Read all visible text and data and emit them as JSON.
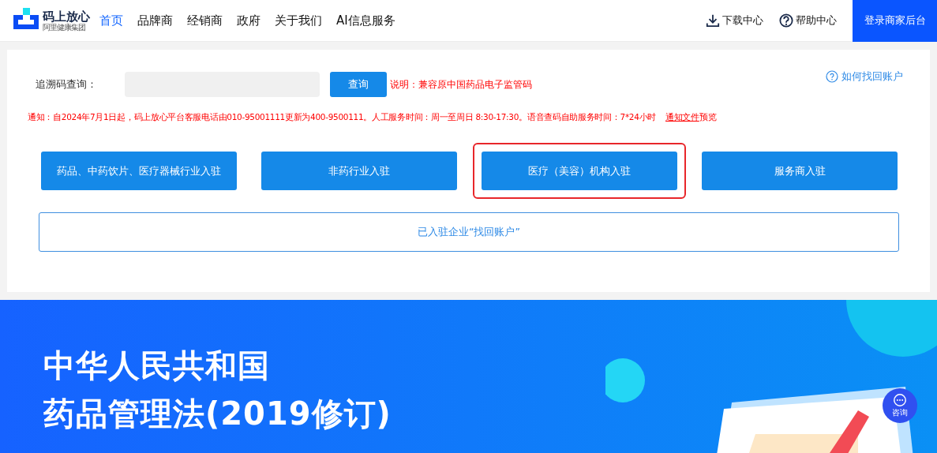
{
  "header": {
    "logo": {
      "name": "码上放心",
      "subtitle": "阿里健康集团"
    },
    "nav": [
      {
        "label": "首页",
        "selected": true
      },
      {
        "label": "品牌商",
        "selected": false
      },
      {
        "label": "经销商",
        "selected": false
      },
      {
        "label": "政府",
        "selected": false
      },
      {
        "label": "关于我们",
        "selected": false
      },
      {
        "label": "AI信息服务",
        "selected": false
      }
    ],
    "tools": [
      {
        "kind": "download",
        "label": "下载中心"
      },
      {
        "kind": "help",
        "label": "帮助中心"
      }
    ],
    "login_button": "登录商家后台"
  },
  "query": {
    "label": "追溯码查询：",
    "button": "查询",
    "note": "说明：兼容原中国药品电子监管码",
    "recover_link": "如何找回账户"
  },
  "notice": {
    "text": "通知：自2024年7月1日起，码上放心平台客服电话由010-95001111更新为400-9500111。人工服务时间：周一至周日 8:30-17:30。语音查码自助服务时间：7*24小时",
    "link": "通知文件",
    "after": "预览"
  },
  "entry_buttons": [
    {
      "label": "药品、中药饮片、医疗器械行业入驻",
      "highlighted": false
    },
    {
      "label": "非药行业入驻",
      "highlighted": false
    },
    {
      "label": "医疗（美容）机构入驻",
      "highlighted": true
    },
    {
      "label": "服务商入驻",
      "highlighted": false
    }
  ],
  "recover_button": "已入驻企业“找回账户”",
  "banner": {
    "lines": [
      "中华人民共和国",
      "药品管理法(2019修订)"
    ]
  },
  "consult_button": "咨询"
}
